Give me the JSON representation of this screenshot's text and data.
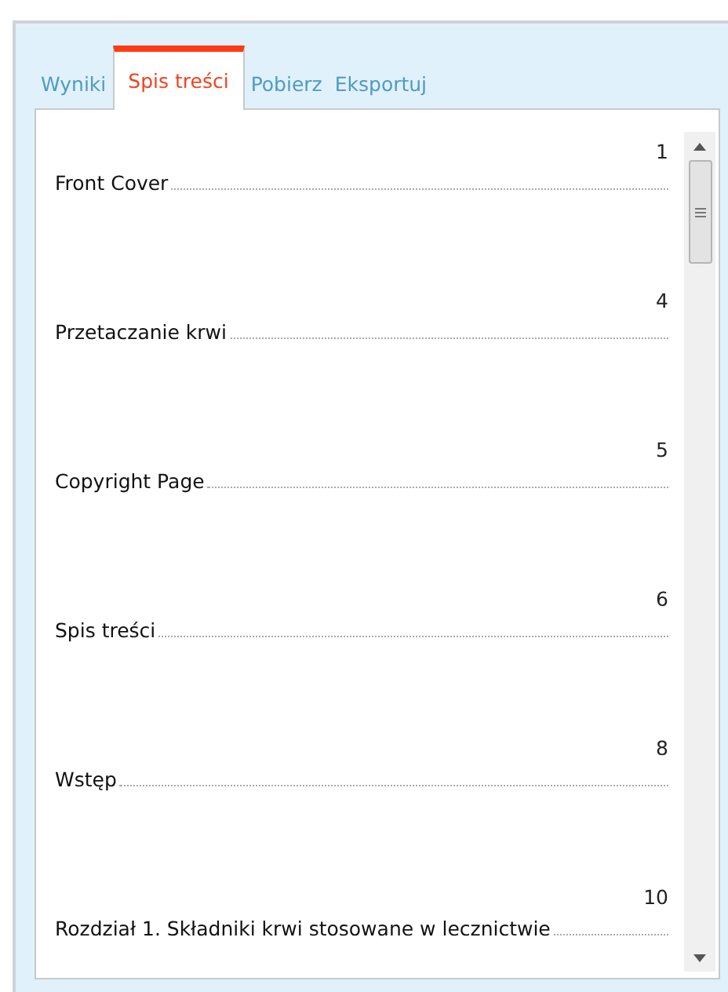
{
  "tabs": [
    {
      "label": "Wyniki",
      "selected": false
    },
    {
      "label": "Spis treści",
      "selected": true
    },
    {
      "label": "Pobierz",
      "selected": false
    },
    {
      "label": "Eksportuj",
      "selected": false
    }
  ],
  "toc": [
    {
      "page": "1",
      "title": "Front Cover"
    },
    {
      "page": "4",
      "title": "Przetaczanie krwi"
    },
    {
      "page": "5",
      "title": "Copyright Page"
    },
    {
      "page": "6",
      "title": "Spis treści"
    },
    {
      "page": "8",
      "title": "Wstęp"
    },
    {
      "page": "10",
      "title": "Rozdział 1. Składniki krwi stosowane w lecznictwie"
    }
  ]
}
